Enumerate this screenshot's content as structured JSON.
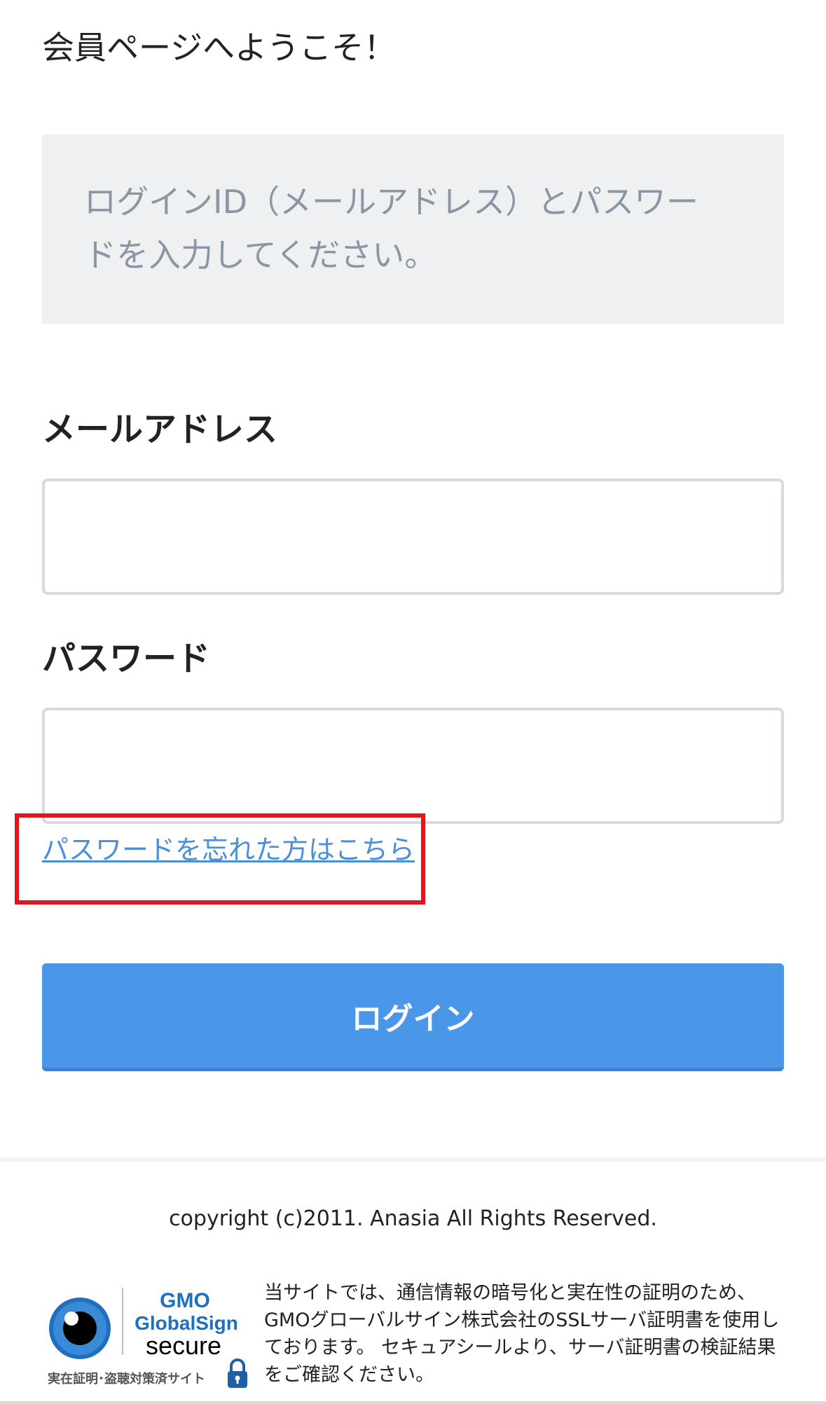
{
  "header": {
    "title": "会員ページへようこそ！"
  },
  "notice": {
    "line1": "ログインID（メールアドレス）とパスワー",
    "line2": "ドを入力してください。"
  },
  "form": {
    "email_label": "メールアドレス",
    "email_value": "",
    "password_label": "パスワード",
    "password_value": "",
    "forgot_link": "パスワードを忘れた方はこちら",
    "login_button": "ログイン"
  },
  "footer": {
    "copyright": "copyright (c)2011. Anasia All Rights Reserved.",
    "seal": {
      "brand": "GMO",
      "name": "GlobalSign",
      "secure": "secure",
      "caption": "実在証明･盗聴対策済サイト"
    },
    "ssl_notice": "当サイトでは、通信情報の暗号化と実在性の証明のため、GMOグローバルサイン株式会社のSSLサーバ証明書を使用しております。 セキュアシールより、サーバ証明書の検証結果をご確認ください。"
  },
  "colors": {
    "accent": "#4a96e8",
    "link": "#4a8fd8",
    "highlight": "#e3141b",
    "notice_bg": "#eef0f2"
  }
}
